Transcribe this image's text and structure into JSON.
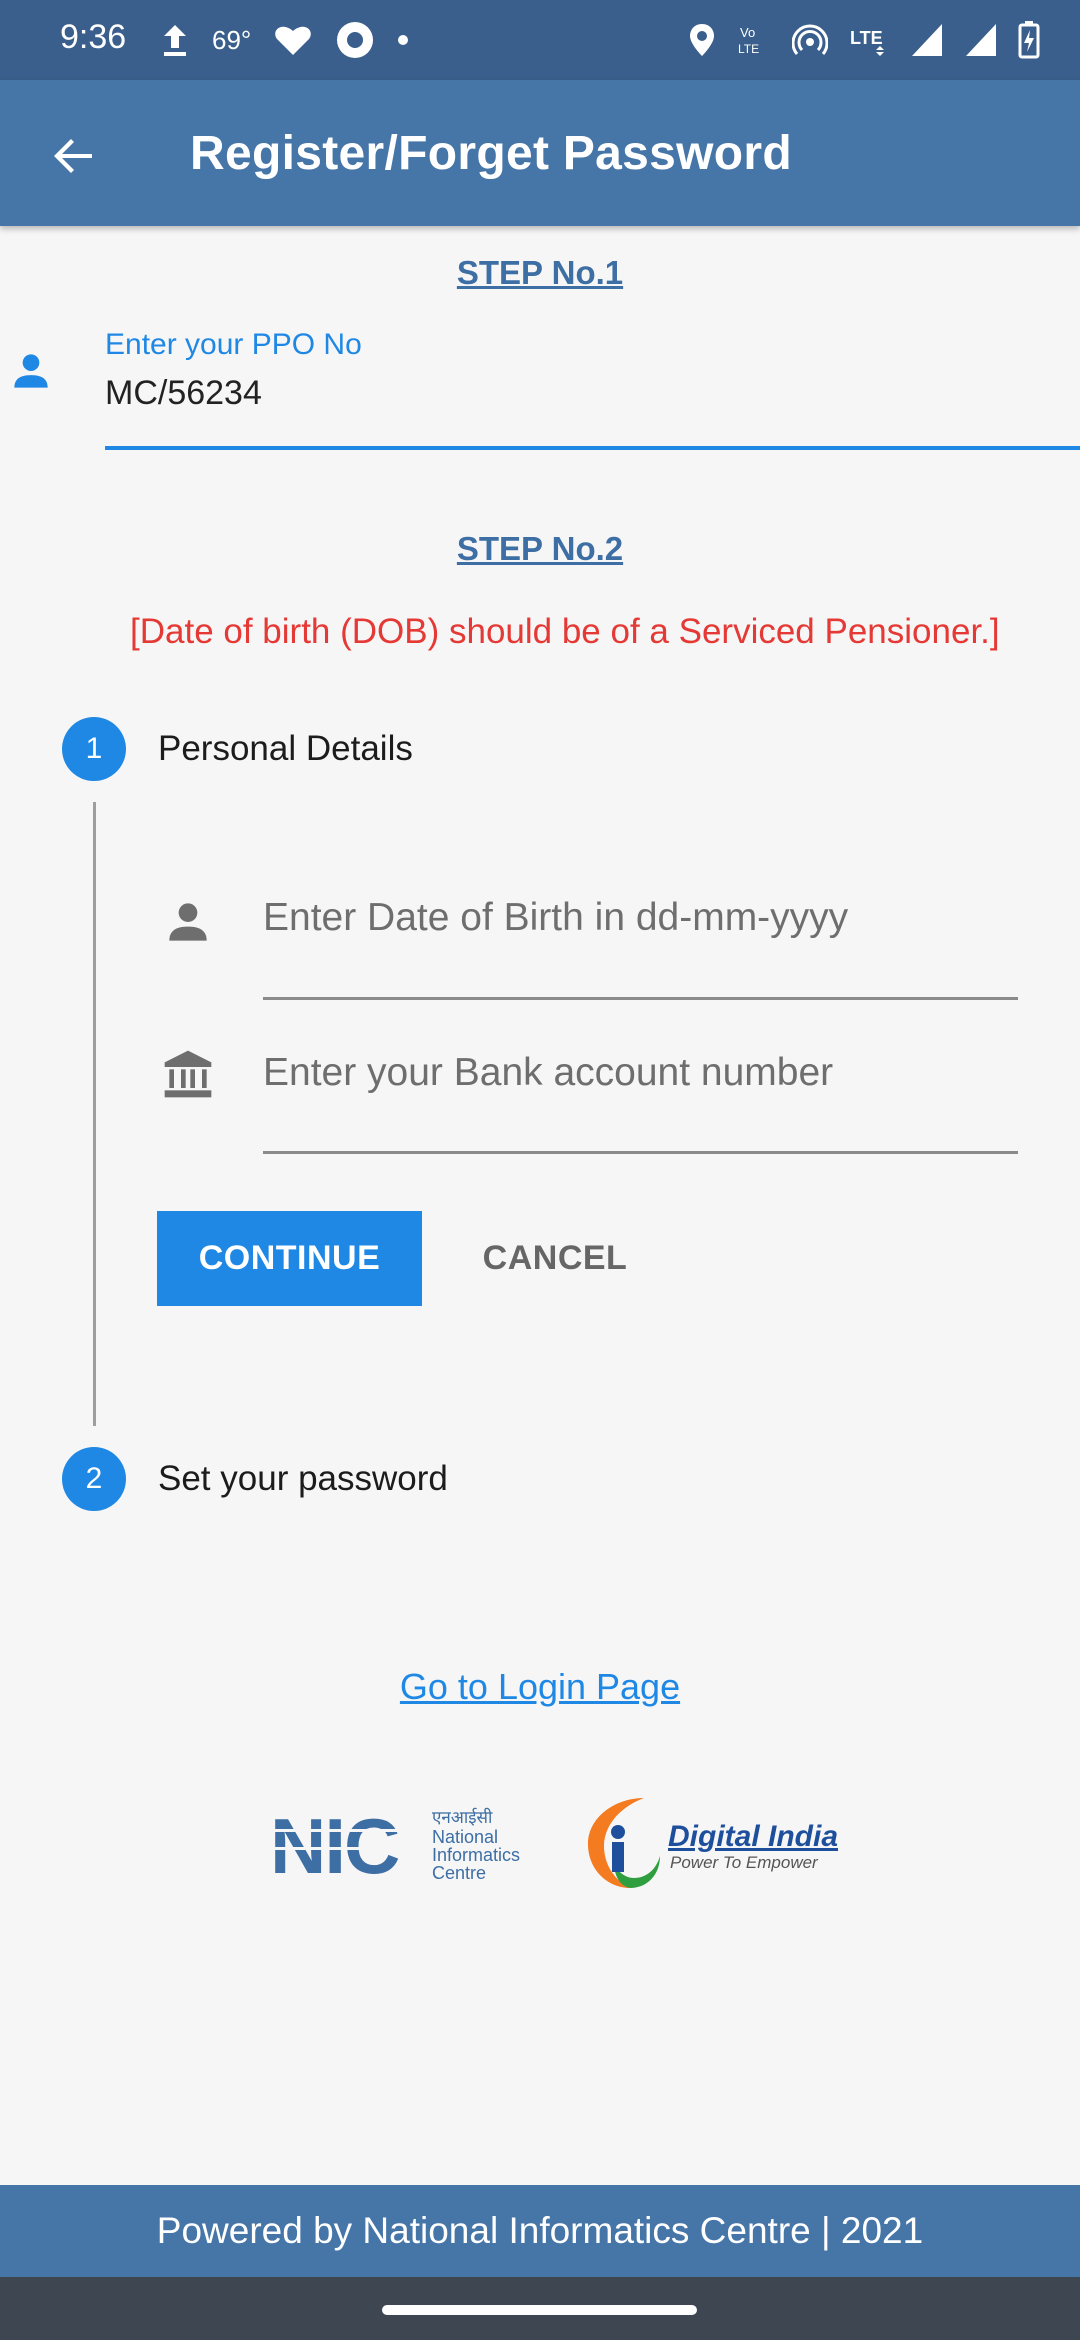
{
  "status_bar": {
    "time": "9:36",
    "temperature": "69°",
    "icons": [
      "upload-icon",
      "heart-icon",
      "app-icon",
      "dot-icon",
      "location-icon",
      "volte-icon",
      "hotspot-icon",
      "lte-icon",
      "signal-icon",
      "signal-icon",
      "battery-charging-icon"
    ]
  },
  "app_bar": {
    "title": "Register/Forget Password",
    "back_icon": "arrow-back-icon"
  },
  "step1": {
    "title": "STEP No.1",
    "ppo_label": "Enter your PPO No",
    "ppo_value": "MC/56234",
    "icon": "person-icon"
  },
  "step2": {
    "title": "STEP No.2",
    "warning": "[Date of birth (DOB) should be of a Serviced Pensioner.]"
  },
  "stepper": {
    "steps": [
      {
        "number": "1",
        "label": "Personal Details"
      },
      {
        "number": "2",
        "label": "Set your password"
      }
    ],
    "fields": [
      {
        "placeholder": "Enter Date of Birth in dd-mm-yyyy",
        "icon": "person-icon"
      },
      {
        "placeholder": "Enter your Bank account number",
        "icon": "bank-icon"
      }
    ],
    "continue_label": "CONTINUE",
    "cancel_label": "CANCEL"
  },
  "login_link": "Go to Login Page",
  "logos": {
    "nic": {
      "mark": "NIC",
      "hindi": "एनआईसी",
      "line1": "National",
      "line2": "Informatics",
      "line3": "Centre"
    },
    "digital_india": {
      "name": "Digital India",
      "tagline": "Power To Empower"
    }
  },
  "footer": "Powered by National Informatics Centre | 2021",
  "colors": {
    "status_bar": "#3a5f8c",
    "app_bar": "#4676a8",
    "accent": "#1f88e5",
    "warning": "#e53935",
    "step_title": "#3d6ea4"
  }
}
